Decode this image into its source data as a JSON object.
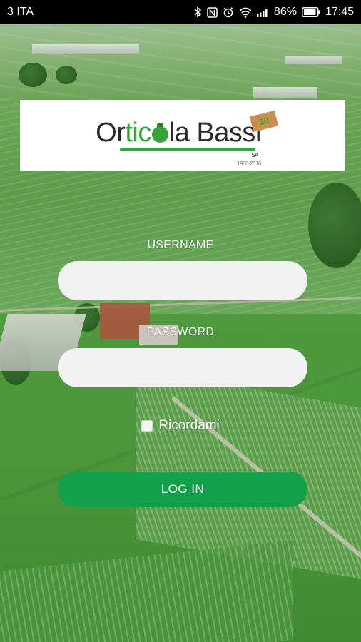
{
  "status_bar": {
    "carrier": "3 ITA",
    "battery_percent": "86%",
    "time": "17:45",
    "icons": [
      "bluetooth-icon",
      "nfc-icon",
      "alarm-icon",
      "wifi-icon",
      "signal-icon",
      "battery-icon"
    ]
  },
  "logo": {
    "text_before": "Or",
    "text_green": "tic",
    "text_after": "la Bass",
    "text_end": "i",
    "suffix": "SA",
    "years": "1986-2016",
    "badge": "30"
  },
  "form": {
    "username_label": "USERNAME",
    "username_value": "",
    "password_label": "PASSWORD",
    "password_value": "",
    "remember_label": "Ricordami",
    "remember_checked": false,
    "login_label": "LOG IN"
  },
  "colors": {
    "accent": "#12a04a",
    "logo_green": "#3aa23a",
    "badge": "#c98f4d"
  }
}
